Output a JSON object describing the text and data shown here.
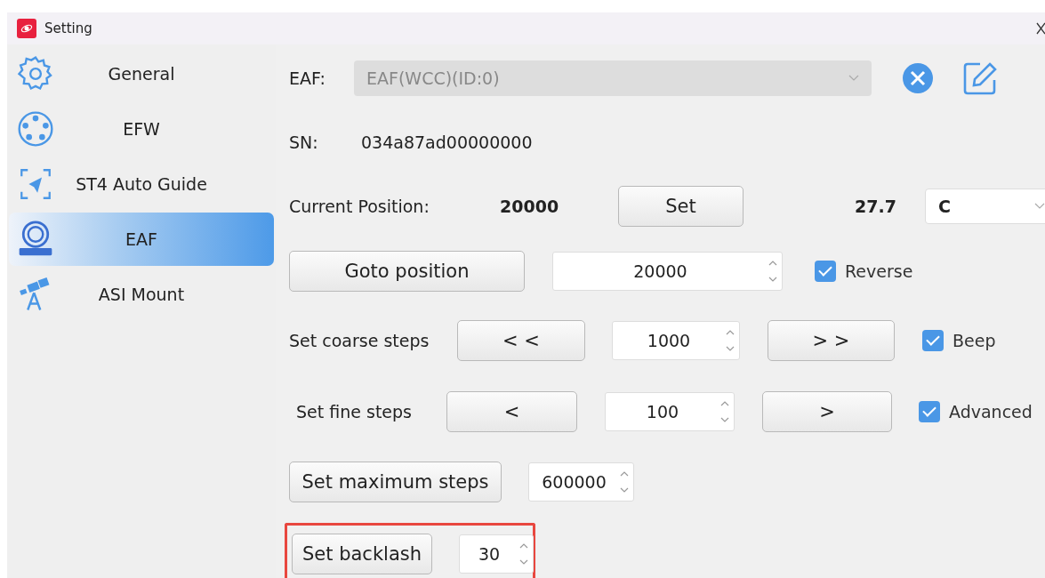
{
  "window": {
    "title": "Setting"
  },
  "sidebar": {
    "items": [
      {
        "label": "General",
        "kind": "gear",
        "selected": false
      },
      {
        "label": "EFW",
        "kind": "wheel",
        "selected": false
      },
      {
        "label": "ST4 Auto Guide",
        "kind": "guide",
        "selected": false
      },
      {
        "label": "EAF",
        "kind": "focuser",
        "selected": true
      },
      {
        "label": "ASI Mount",
        "kind": "telescope",
        "selected": false
      }
    ]
  },
  "eaf": {
    "label": "EAF:",
    "device": {
      "value": "EAF(WCC)(ID:0)",
      "disabled": true
    }
  },
  "sn": {
    "label": "SN:",
    "value": "034a87ad00000000"
  },
  "current_position": {
    "label": "Current Position:",
    "value": "20000",
    "button": "Set",
    "temperature": "27.7",
    "unit": {
      "value": "C"
    }
  },
  "goto": {
    "button": "Goto position",
    "value": "20000",
    "checkbox": {
      "label": "Reverse",
      "checked": true
    }
  },
  "coarse": {
    "label": "Set coarse steps",
    "decrease": "< <",
    "value": "1000",
    "increase": "> >",
    "checkbox": {
      "label": "Beep",
      "checked": true
    }
  },
  "fine": {
    "label": "Set fine steps",
    "decrease": "<",
    "value": "100",
    "increase": ">",
    "checkbox": {
      "label": "Advanced",
      "checked": true
    }
  },
  "max_steps": {
    "button": "Set maximum steps",
    "value": "600000"
  },
  "backlash": {
    "button": "Set backlash",
    "value": "30",
    "highlighted": true
  }
}
